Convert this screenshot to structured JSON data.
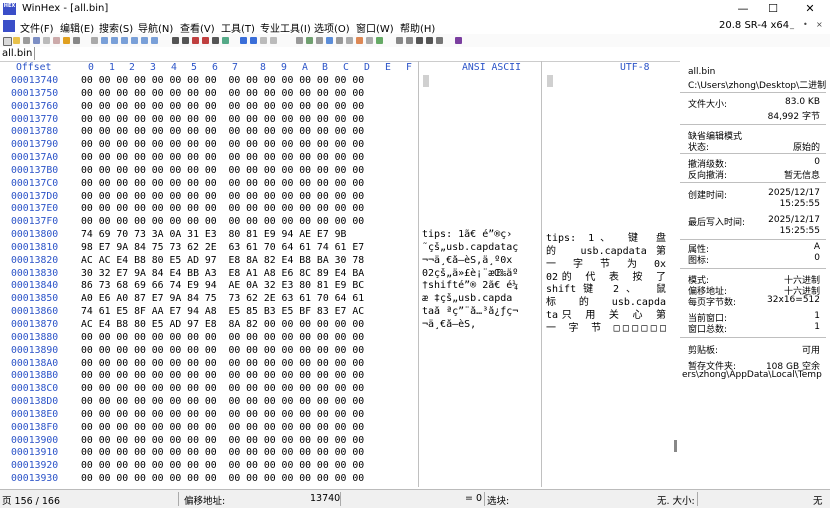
{
  "window": {
    "title": "WinHex - [all.bin]",
    "icon_label": "HEX"
  },
  "menu": {
    "items": [
      "文件(F)",
      "编辑(E)",
      "搜索(S)",
      "导航(N)",
      "查看(V)",
      "工具(T)",
      "专业工具(I)",
      "选项(O)",
      "窗口(W)",
      "帮助(H)"
    ],
    "version": "20.8 SR-4 x64",
    "mini_buttons": [
      "_",
      "•",
      "×"
    ]
  },
  "tab": {
    "label": "all.bin"
  },
  "hex_view": {
    "offset_header": "Offset",
    "column_headers": [
      "0",
      "1",
      "2",
      "3",
      "4",
      "5",
      "6",
      "7",
      "8",
      "9",
      "A",
      "B",
      "C",
      "D",
      "E",
      "F"
    ],
    "ansi_header": "ANSI ASCII",
    "utf_header": "UTF-8",
    "rows": [
      {
        "offset": "00013740",
        "hex": "00 00 00 00 00 00 00 00  00 00 00 00 00 00 00 00",
        "ansi": "",
        "utf": ""
      },
      {
        "offset": "00013750",
        "hex": "00 00 00 00 00 00 00 00  00 00 00 00 00 00 00 00",
        "ansi": "",
        "utf": ""
      },
      {
        "offset": "00013760",
        "hex": "00 00 00 00 00 00 00 00  00 00 00 00 00 00 00 00",
        "ansi": "",
        "utf": ""
      },
      {
        "offset": "00013770",
        "hex": "00 00 00 00 00 00 00 00  00 00 00 00 00 00 00 00",
        "ansi": "",
        "utf": ""
      },
      {
        "offset": "00013780",
        "hex": "00 00 00 00 00 00 00 00  00 00 00 00 00 00 00 00",
        "ansi": "",
        "utf": ""
      },
      {
        "offset": "00013790",
        "hex": "00 00 00 00 00 00 00 00  00 00 00 00 00 00 00 00",
        "ansi": "",
        "utf": ""
      },
      {
        "offset": "000137A0",
        "hex": "00 00 00 00 00 00 00 00  00 00 00 00 00 00 00 00",
        "ansi": "",
        "utf": ""
      },
      {
        "offset": "000137B0",
        "hex": "00 00 00 00 00 00 00 00  00 00 00 00 00 00 00 00",
        "ansi": "",
        "utf": ""
      },
      {
        "offset": "000137C0",
        "hex": "00 00 00 00 00 00 00 00  00 00 00 00 00 00 00 00",
        "ansi": "",
        "utf": ""
      },
      {
        "offset": "000137D0",
        "hex": "00 00 00 00 00 00 00 00  00 00 00 00 00 00 00 00",
        "ansi": "",
        "utf": ""
      },
      {
        "offset": "000137E0",
        "hex": "00 00 00 00 00 00 00 00  00 00 00 00 00 00 00 00",
        "ansi": "",
        "utf": ""
      },
      {
        "offset": "000137F0",
        "hex": "00 00 00 00 00 00 00 00  00 00 00 00 00 00 00 00",
        "ansi": "",
        "utf": ""
      },
      {
        "offset": "00013800",
        "hex": "74 69 70 73 3A 0A 31 E3  80 81 E9 94 AE E7 9B",
        "ansi": "tips: 1ã€ é”®ç›",
        "utf": "tips: 1、 键 盘"
      },
      {
        "offset": "00013810",
        "hex": "98 E7 9A 84 75 73 62 2E  63 61 70 64 61 74 61 E7",
        "ansi": "˜çš„usb.capdataç",
        "utf": "的 usb.capdata第"
      },
      {
        "offset": "00013820",
        "hex": "AC AC E4 B8 80 E5 AD 97  E8 8A 82 E4 B8 BA 30 78",
        "ansi": "¬¬ä¸€å­—èŠ‚ä¸º0x",
        "utf": "一 字 节 为 0x"
      },
      {
        "offset": "00013830",
        "hex": "30 32 E7 9A 84 E4 BB A3  E8 A1 A8 E6 8C 89 E4 BA",
        "ansi": "02çš„ä»£è¡¨æŒ‰äº",
        "utf": "02的 代 表 按 了"
      },
      {
        "offset": "00013840",
        "hex": "86 73 68 69 66 74 E9 94  AE 0A 32 E3 80 81 E9 BC",
        "ansi": "†shifté”® 2ã€ é¼",
        "utf": "shift键 2、 鼠"
      },
      {
        "offset": "00013850",
        "hex": "A0 E6 A0 87 E7 9A 84 75  73 62 2E 63 61 70 64 61",
        "ansi": " æ ‡çš„usb.capda",
        "utf": "标 的 usb.capda"
      },
      {
        "offset": "00013860",
        "hex": "74 61 E5 8F AA E7 94 A8  E5 85 B3 E5 BF 83 E7 AC",
        "ansi": "taå ªç”¨å…³å¿ƒç¬",
        "utf": "ta只 用 关 心 第"
      },
      {
        "offset": "00013870",
        "hex": "AC E4 B8 80 E5 AD 97 E8  8A 82 00 00 00 00 00 00",
        "ansi": "¬ä¸€å­—èŠ‚",
        "utf": "一 字 节 □□□□□□"
      },
      {
        "offset": "00013880",
        "hex": "00 00 00 00 00 00 00 00  00 00 00 00 00 00 00 00",
        "ansi": "",
        "utf": ""
      },
      {
        "offset": "00013890",
        "hex": "00 00 00 00 00 00 00 00  00 00 00 00 00 00 00 00",
        "ansi": "",
        "utf": ""
      },
      {
        "offset": "000138A0",
        "hex": "00 00 00 00 00 00 00 00  00 00 00 00 00 00 00 00",
        "ansi": "",
        "utf": ""
      },
      {
        "offset": "000138B0",
        "hex": "00 00 00 00 00 00 00 00  00 00 00 00 00 00 00 00",
        "ansi": "",
        "utf": ""
      },
      {
        "offset": "000138C0",
        "hex": "00 00 00 00 00 00 00 00  00 00 00 00 00 00 00 00",
        "ansi": "",
        "utf": ""
      },
      {
        "offset": "000138D0",
        "hex": "00 00 00 00 00 00 00 00  00 00 00 00 00 00 00 00",
        "ansi": "",
        "utf": ""
      },
      {
        "offset": "000138E0",
        "hex": "00 00 00 00 00 00 00 00  00 00 00 00 00 00 00 00",
        "ansi": "",
        "utf": ""
      },
      {
        "offset": "000138F0",
        "hex": "00 00 00 00 00 00 00 00  00 00 00 00 00 00 00 00",
        "ansi": "",
        "utf": ""
      },
      {
        "offset": "00013900",
        "hex": "00 00 00 00 00 00 00 00  00 00 00 00 00 00 00 00",
        "ansi": "",
        "utf": ""
      },
      {
        "offset": "00013910",
        "hex": "00 00 00 00 00 00 00 00  00 00 00 00 00 00 00 00",
        "ansi": "",
        "utf": ""
      },
      {
        "offset": "00013920",
        "hex": "00 00 00 00 00 00 00 00  00 00 00 00 00 00 00 00",
        "ansi": "",
        "utf": ""
      },
      {
        "offset": "00013930",
        "hex": "00 00 00 00 00 00 00 00  00 00 00 00 00 00 00 00",
        "ansi": "",
        "utf": ""
      }
    ]
  },
  "info_panel": {
    "file_name": "all.bin",
    "path": "C:\\Users\\zhong\\Desktop\\二进制",
    "size_label": "文件大小:",
    "size_kb": "83.0 KB",
    "size_bytes": "84,992 字节",
    "default_mode_label": "缺省编辑模式",
    "state_label": "状态:",
    "state_value": "原始的",
    "undo_level_label": "撤消级数:",
    "undo_level_value": "0",
    "reverse_undo_label": "反向撤消:",
    "reverse_undo_value": "暂无信息",
    "created_label": "创建时间:",
    "created_date": "2025/12/17",
    "created_time": "15:25:55",
    "written_label": "最后写入时间:",
    "written_date": "2025/12/17",
    "written_time": "15:25:55",
    "attr_label": "属性:",
    "attr_value": "A",
    "icon_label": "图标:",
    "icon_value": "0",
    "mode_label": "模式:",
    "mode_value": "十六进制",
    "offset_mode_label": "偏移地址:",
    "offset_mode_value": "十六进制",
    "bytes_per_page_label": "每页字节数:",
    "bytes_per_page_value": "32x16=512",
    "current_window_label": "当前窗口:",
    "current_window_value": "1",
    "window_total_label": "窗口总数:",
    "window_total_value": "1",
    "clipboard_label": "剪贴板:",
    "clipboard_value": "可用",
    "temp_folder_label": "暂存文件夹:",
    "temp_folder_value": "108 GB 空余",
    "temp_folder_path": "ers\\zhong\\AppData\\Local\\Temp"
  },
  "status": {
    "page": "页 156 / 166",
    "offset_label": "偏移地址:",
    "offset_value": "13740",
    "value_text": "= 0",
    "selection_label": "选块:",
    "size_text": "无. 大小:",
    "right_text": "无"
  }
}
